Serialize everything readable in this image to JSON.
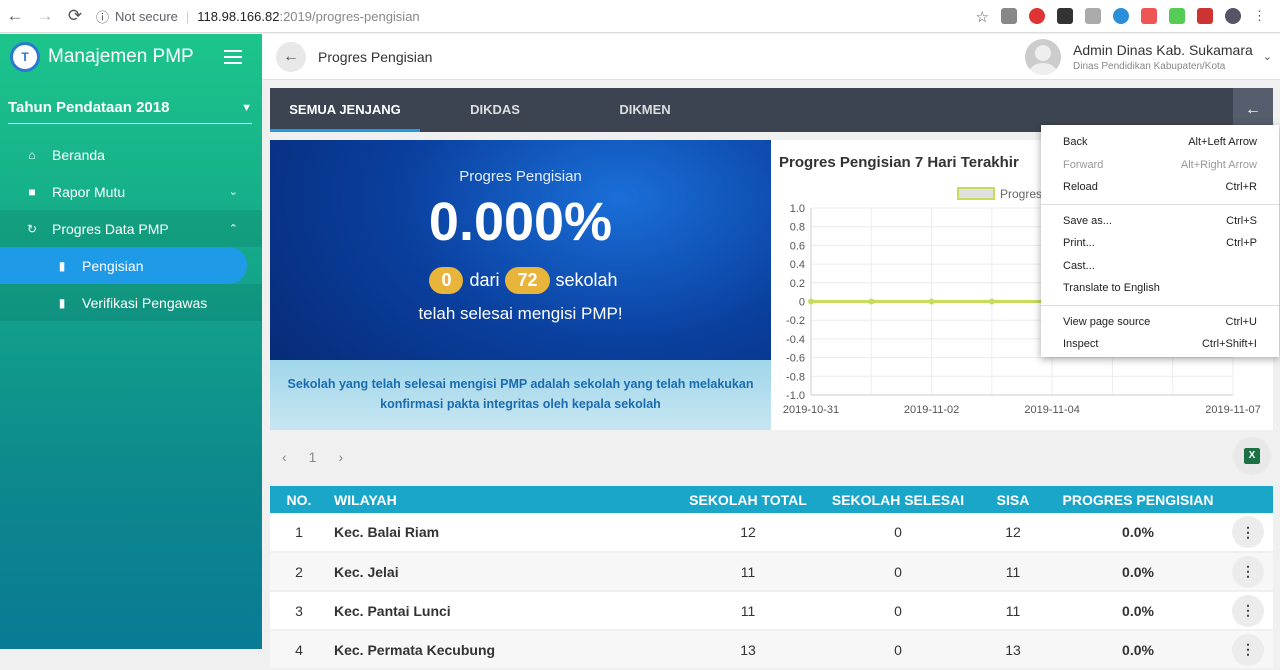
{
  "browser": {
    "status": "Not secure",
    "host": "118.98.166.82",
    "path": ":2019/progres-pengisian"
  },
  "sidebar": {
    "app_name": "Manajemen PMP",
    "year": "Tahun Pendataan 2018",
    "items": [
      {
        "label": "Beranda",
        "icon": "home-icon"
      },
      {
        "label": "Rapor Mutu",
        "icon": "book-icon"
      },
      {
        "label": "Progres Data PMP",
        "icon": "refresh-icon"
      },
      {
        "label": "Pengisian",
        "icon": "bar-chart-icon"
      },
      {
        "label": "Verifikasi Pengawas",
        "icon": "bar-chart-icon"
      }
    ]
  },
  "header": {
    "title": "Progres Pengisian",
    "user_name": "Admin Dinas Kab. Sukamara",
    "user_org": "Dinas Pendidikan Kabupaten/Kota"
  },
  "tabs": [
    "SEMUA JENJANG",
    "DIKDAS",
    "DIKMEN"
  ],
  "hero": {
    "label": "Progres Pengisian",
    "percent": "0.000%",
    "done": "0",
    "dari": "dari",
    "total": "72",
    "sekolah": "sekolah",
    "sub": "telah selesai mengisi PMP!",
    "note": "Sekolah yang telah selesai mengisi PMP adalah sekolah yang telah melakukan konfirmasi pakta integritas oleh kepala sekolah"
  },
  "chart_data": {
    "type": "line",
    "title": "Progres Pengisian 7 Hari Terakhir",
    "series": [
      {
        "name": "Progres",
        "values": [
          0,
          0,
          0,
          0,
          0,
          0,
          0,
          0
        ]
      }
    ],
    "x": [
      "2019-10-31",
      "2019-11-01",
      "2019-11-02",
      "2019-11-03",
      "2019-11-04",
      "2019-11-05",
      "2019-11-06",
      "2019-11-07"
    ],
    "xticks": [
      "2019-10-31",
      "2019-11-02",
      "2019-11-04",
      "2019-11-07"
    ],
    "ylim": [
      -1.0,
      1.0
    ],
    "yticks": [
      "1.0",
      "0.8",
      "0.6",
      "0.4",
      "0.2",
      "0",
      "-0.2",
      "-0.4",
      "-0.6",
      "-0.8",
      "-1.0"
    ],
    "color": "#c8dc5a",
    "legend": "top"
  },
  "pagination": {
    "page": "1"
  },
  "table": {
    "headers": [
      "NO.",
      "WILAYAH",
      "SEKOLAH TOTAL",
      "SEKOLAH SELESAI",
      "SISA",
      "PROGRES PENGISIAN"
    ],
    "rows": [
      [
        "1",
        "Kec. Balai Riam",
        "12",
        "0",
        "12",
        "0.0%"
      ],
      [
        "2",
        "Kec. Jelai",
        "11",
        "0",
        "11",
        "0.0%"
      ],
      [
        "3",
        "Kec. Pantai Lunci",
        "11",
        "0",
        "11",
        "0.0%"
      ],
      [
        "4",
        "Kec. Permata Kecubung",
        "13",
        "0",
        "13",
        "0.0%"
      ]
    ]
  },
  "context_menu": [
    {
      "label": "Back",
      "key": "Alt+Left Arrow"
    },
    {
      "label": "Forward",
      "key": "Alt+Right Arrow",
      "disabled": true
    },
    {
      "label": "Reload",
      "key": "Ctrl+R"
    },
    {
      "label": "Save as...",
      "key": "Ctrl+S"
    },
    {
      "label": "Print...",
      "key": "Ctrl+P"
    },
    {
      "label": "Cast...",
      "key": ""
    },
    {
      "label": "Translate to English",
      "key": ""
    },
    {
      "label": "View page source",
      "key": "Ctrl+U"
    },
    {
      "label": "Inspect",
      "key": "Ctrl+Shift+I"
    }
  ]
}
